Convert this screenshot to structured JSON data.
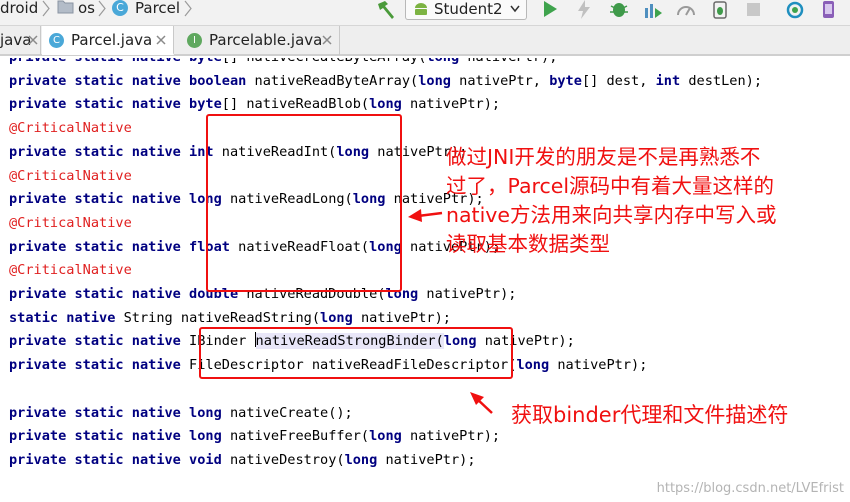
{
  "breadcrumb": [
    "droid",
    "os",
    "Parcel"
  ],
  "run_config": {
    "label": "Student2"
  },
  "tabs": [
    {
      "label": "java",
      "active": false
    },
    {
      "label": "Parcel.java",
      "active": true,
      "icon_letter": "C"
    },
    {
      "label": "Parcelable.java",
      "active": false,
      "icon_letter": "I"
    }
  ],
  "code_lines": [
    {
      "tokens": [
        {
          "t": "private static native ",
          "c": "kw"
        },
        {
          "t": "byte",
          "c": "kw"
        },
        {
          "t": "[] nativeCreateByteArray("
        },
        {
          "t": "long",
          "c": "kw"
        },
        {
          "t": " nativePtr);"
        }
      ]
    },
    {
      "tokens": [
        {
          "t": "private static native boolean",
          "c": "kw"
        },
        {
          "t": " nativeReadByteArray("
        },
        {
          "t": "long",
          "c": "kw"
        },
        {
          "t": " nativePtr, "
        },
        {
          "t": "byte",
          "c": "kw"
        },
        {
          "t": "[] dest, "
        },
        {
          "t": "int",
          "c": "kw"
        },
        {
          "t": " destLen);"
        }
      ]
    },
    {
      "tokens": [
        {
          "t": "private static native byte",
          "c": "kw"
        },
        {
          "t": "[] nativeReadBlob("
        },
        {
          "t": "long",
          "c": "kw"
        },
        {
          "t": " nativePtr);"
        }
      ]
    },
    {
      "tokens": [
        {
          "t": "@CriticalNative",
          "c": "ann"
        }
      ]
    },
    {
      "tokens": [
        {
          "t": "private static native int",
          "c": "kw"
        },
        {
          "t": " nativeReadInt("
        },
        {
          "t": "long",
          "c": "kw"
        },
        {
          "t": " nativePtr);"
        }
      ]
    },
    {
      "tokens": [
        {
          "t": "@CriticalNative",
          "c": "ann"
        }
      ]
    },
    {
      "tokens": [
        {
          "t": "private static native long",
          "c": "kw"
        },
        {
          "t": " nativeReadLong("
        },
        {
          "t": "long",
          "c": "kw"
        },
        {
          "t": " nativePtr);"
        }
      ]
    },
    {
      "tokens": [
        {
          "t": "@CriticalNative",
          "c": "ann"
        }
      ]
    },
    {
      "tokens": [
        {
          "t": "private static native float",
          "c": "kw"
        },
        {
          "t": " nativeReadFloat("
        },
        {
          "t": "long",
          "c": "kw"
        },
        {
          "t": " nativePtr);"
        }
      ]
    },
    {
      "tokens": [
        {
          "t": "@CriticalNative",
          "c": "ann"
        }
      ]
    },
    {
      "tokens": [
        {
          "t": "private static native double",
          "c": "kw"
        },
        {
          "t": " nativeReadDouble("
        },
        {
          "t": "long",
          "c": "kw"
        },
        {
          "t": " nativePtr);"
        }
      ]
    },
    {
      "tokens": [
        {
          "t": "static native",
          "c": "kw"
        },
        {
          "t": " String nativeReadString("
        },
        {
          "t": "long",
          "c": "kw"
        },
        {
          "t": " nativePtr);"
        }
      ]
    },
    {
      "tokens": [
        {
          "t": "private static native",
          "c": "kw"
        },
        {
          "t": " IBinder "
        },
        {
          "t": "",
          "c": "caret"
        },
        {
          "t": "nativeReadStrongBinder(",
          "c": "hl"
        },
        {
          "t": "long",
          "c": "kw"
        },
        {
          "t": " nativePtr);"
        }
      ]
    },
    {
      "tokens": [
        {
          "t": "private static native",
          "c": "kw"
        },
        {
          "t": " FileDescriptor nativeReadFileDescriptor("
        },
        {
          "t": "long",
          "c": "kw"
        },
        {
          "t": " nativePtr);"
        }
      ]
    },
    {
      "tokens": []
    },
    {
      "tokens": [
        {
          "t": "private static native long",
          "c": "kw"
        },
        {
          "t": " nativeCreate();"
        }
      ]
    },
    {
      "tokens": [
        {
          "t": "private static native long",
          "c": "kw"
        },
        {
          "t": " nativeFreeBuffer("
        },
        {
          "t": "long",
          "c": "kw"
        },
        {
          "t": " nativePtr);"
        }
      ]
    },
    {
      "tokens": [
        {
          "t": "private static native void",
          "c": "kw"
        },
        {
          "t": " nativeDestroy("
        },
        {
          "t": "long",
          "c": "kw"
        },
        {
          "t": " nativePtr);"
        }
      ]
    }
  ],
  "annotations": {
    "note1": [
      "做过JNI开发的朋友是不是再熟悉不",
      "过了，Parcel源码中有着大量这样的",
      "native方法用来向共享内存中写入或",
      "读取基本数据类型"
    ],
    "note2": "获取binder代理和文件描述符",
    "color": "#f01010"
  },
  "watermark": "https://blog.csdn.net/LVEfrist"
}
